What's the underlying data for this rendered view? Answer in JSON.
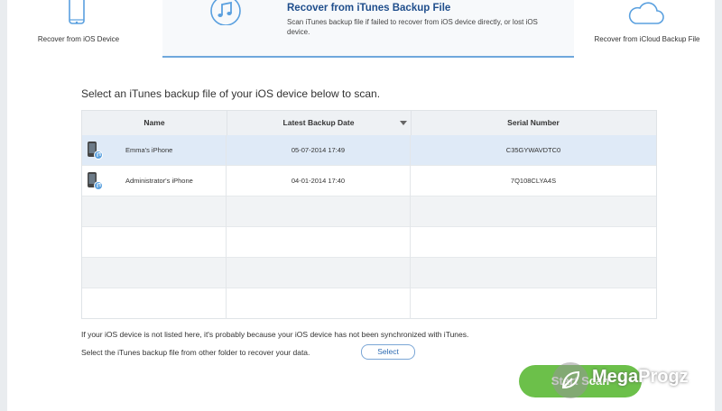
{
  "modes": {
    "ios": {
      "label": "Recover from iOS Device",
      "icon": "iphone-icon"
    },
    "itunes": {
      "title": "Recover from iTunes Backup File",
      "description": "Scan iTunes backup file if failed to recover from iOS device directly, or lost iOS device.",
      "icon": "music-note-icon",
      "active": true
    },
    "icloud": {
      "label": "Recover from iCloud Backup File",
      "icon": "cloud-icon"
    }
  },
  "instruction": "Select an iTunes backup file of your iOS device below to scan.",
  "table": {
    "columns": [
      "Name",
      "Latest Backup Date",
      "Serial Number"
    ],
    "sorted_column": "Latest Backup Date",
    "rows": [
      {
        "name": "Emma's iPhone",
        "date": "05-07-2014 17:49",
        "serial": "C35GYWAVDTC0",
        "selected": true
      },
      {
        "name": "Administrator's iPhone",
        "date": "04-01-2014 17:40",
        "serial": "7Q108CLYA4S",
        "selected": false
      }
    ]
  },
  "footer": {
    "note_not_listed": "If your iOS device is not listed here, it's probably because your iOS device has not been synchronized with iTunes.",
    "note_other_folder": "Select the iTunes backup file from other folder to recover your data.",
    "select_label": "Select"
  },
  "start_button": {
    "label": "Start Scan"
  },
  "watermark": {
    "text": "MegaProgz"
  },
  "colors": {
    "accent_blue": "#1f4e8c",
    "selected_row": "#dfeaf7",
    "start_green": "#6cc04a",
    "icon_blue": "#5aa0df"
  }
}
